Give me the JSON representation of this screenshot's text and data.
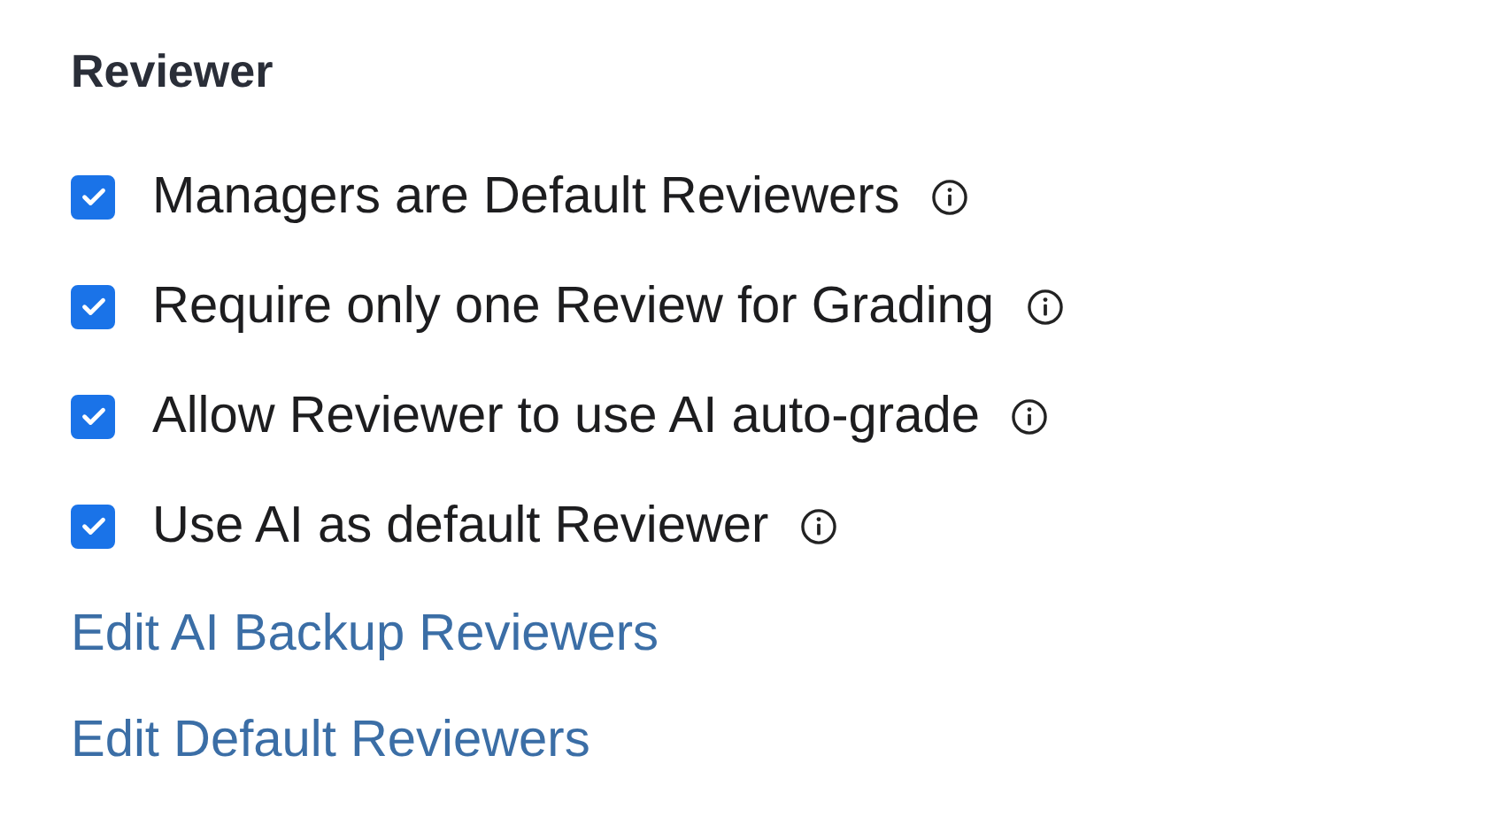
{
  "section": {
    "title": "Reviewer"
  },
  "options": [
    {
      "label": "Managers are Default Reviewers",
      "checked": true
    },
    {
      "label": "Require only one Review for Grading",
      "checked": true
    },
    {
      "label": "Allow Reviewer to use AI auto-grade",
      "checked": true
    },
    {
      "label": "Use AI as default Reviewer",
      "checked": true
    }
  ],
  "links": [
    "Edit AI Backup Reviewers",
    "Edit Default Reviewers"
  ]
}
